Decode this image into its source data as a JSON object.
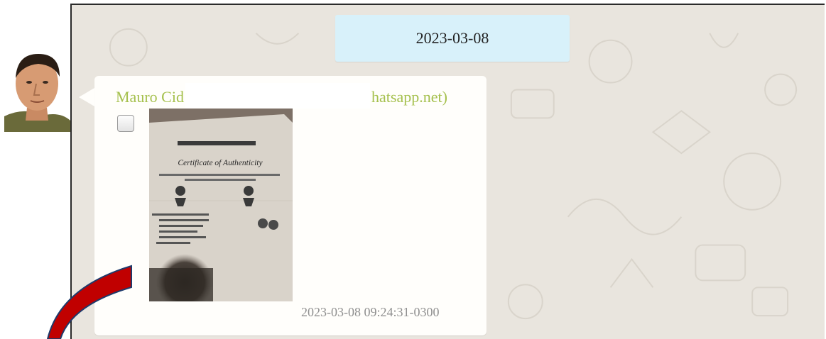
{
  "chat": {
    "date_label": "2023-03-08",
    "message": {
      "sender_name": "Mauro Cid",
      "sender_id_fragment": "hatsapp.net)",
      "checkbox_checked": false,
      "attachment": {
        "title": "Certificate of Authenticity"
      },
      "timestamp": "2023-03-08 09:24:31-0300"
    }
  },
  "colors": {
    "chat_background": "#e9e5de",
    "date_pill": "#d8f1fa",
    "sender_name": "#a5c04d",
    "timestamp": "#8f8f8f",
    "annotation_arrow": "#c00000"
  }
}
